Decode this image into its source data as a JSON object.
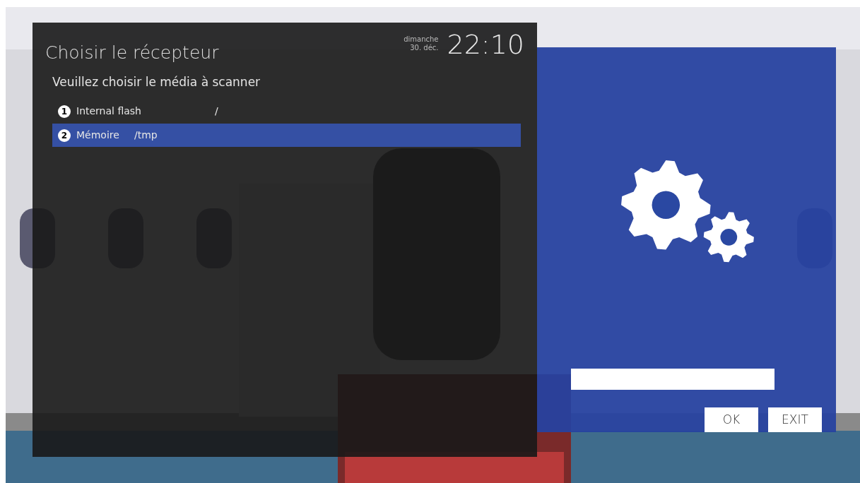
{
  "dialog": {
    "title": "Choisir le récepteur",
    "day": "dimanche",
    "date": "30. déc.",
    "time": "22:10",
    "prompt": "Veuillez choisir le média à scanner",
    "items": [
      {
        "number": "1",
        "name": "Internal flash",
        "path": "/",
        "selected": false
      },
      {
        "number": "2",
        "name": "Mémoire",
        "path": "/tmp",
        "selected": true
      }
    ]
  },
  "side_panel": {
    "buttons": [
      "OK",
      "EXIT"
    ]
  }
}
